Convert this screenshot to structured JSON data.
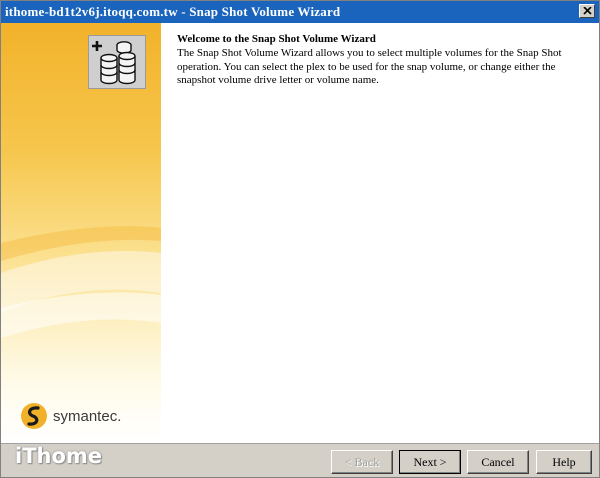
{
  "window": {
    "title": "ithome-bd1t2v6j.itoqq.com.tw - Snap Shot Volume Wizard"
  },
  "banner": {
    "brand": "symantec."
  },
  "content": {
    "heading": "Welcome to the Snap Shot Volume Wizard",
    "description": "The Snap Shot Volume Wizard allows you to select multiple volumes for the Snap Shot operation. You can select the plex to be used for the snap volume, or change either the snapshot volume drive letter or volume name."
  },
  "watermark": "iThome",
  "buttons": {
    "back": {
      "label": "< Back",
      "enabled": false
    },
    "next": {
      "label": "Next >",
      "enabled": true
    },
    "cancel": {
      "label": "Cancel",
      "enabled": true
    },
    "help": {
      "label": "Help",
      "enabled": true
    }
  },
  "colors": {
    "titlebar": "#1a64bd",
    "banner_top": "#f2b22a",
    "banner_bottom": "#ffffff",
    "dialog_face": "#d4d0c8"
  },
  "icons": [
    "close-icon",
    "snapshot-volume-icon",
    "symantec-logo-icon"
  ]
}
